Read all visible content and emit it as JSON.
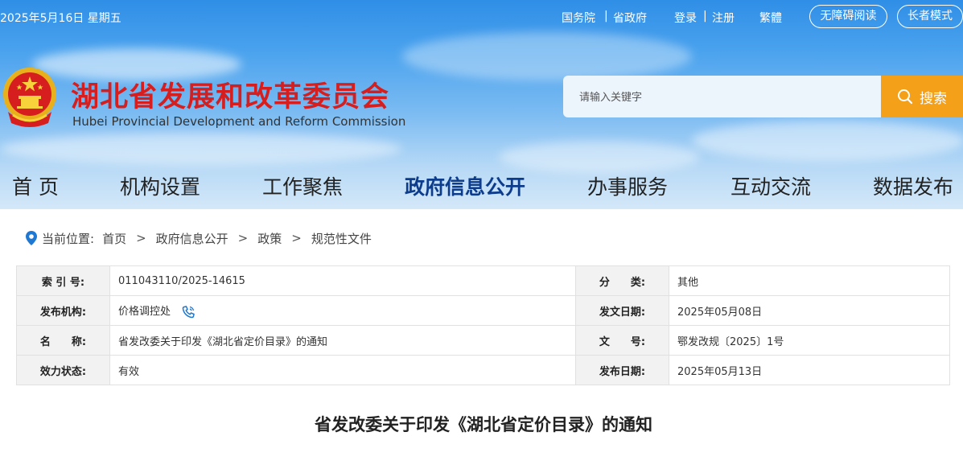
{
  "topbar": {
    "date": "2025年5月16日 星期五",
    "links": {
      "state_council": "国务院",
      "provincial_gov": "省政府",
      "login": "登录",
      "register": "注册",
      "traditional": "繁體"
    },
    "separator": "|",
    "accessible_reading": "无障碍阅读",
    "elder_mode": "长者模式"
  },
  "site": {
    "title": "湖北省发展和改革委员会",
    "subtitle": "Hubei Provincial Development and Reform Commission"
  },
  "search": {
    "placeholder": "请输入关键字",
    "button_label": "搜索"
  },
  "nav": {
    "items": [
      {
        "label": "首 页",
        "active": false
      },
      {
        "label": "机构设置",
        "active": false
      },
      {
        "label": "工作聚焦",
        "active": false
      },
      {
        "label": "政府信息公开",
        "active": true
      },
      {
        "label": "办事服务",
        "active": false
      },
      {
        "label": "互动交流",
        "active": false
      },
      {
        "label": "数据发布",
        "active": false
      }
    ]
  },
  "breadcrumb": {
    "prefix": "当前位置:",
    "items": [
      "首页",
      "政府信息公开",
      "政策",
      "规范性文件"
    ],
    "separator": ">"
  },
  "info_table": {
    "rows": [
      {
        "l1": "索 引 号:",
        "v1": "011043110/2025-14615",
        "l2": "分　　类:",
        "v2": "其他"
      },
      {
        "l1": "发布机构:",
        "v1": "价格调控处",
        "l2": "发文日期:",
        "v2": "2025年05月08日"
      },
      {
        "l1": "名　　称:",
        "v1": "省发改委关于印发《湖北省定价目录》的通知",
        "l2": "文　　号:",
        "v2": "鄂发改规〔2025〕1号"
      },
      {
        "l1": "效力状态:",
        "v1": "有效",
        "l2": "发布日期:",
        "v2": "2025年05月13日"
      }
    ]
  },
  "document": {
    "title": "省发改委关于印发《湖北省定价目录》的通知"
  },
  "colors": {
    "title_red": "#d71e1e",
    "search_orange": "#f4a019",
    "nav_active": "#0d3c8c",
    "header_blue": "#2f8ee6"
  },
  "icons": {
    "emblem": "national-emblem-icon",
    "search": "search-icon",
    "location": "location-pin-icon",
    "phone": "phone-icon"
  }
}
